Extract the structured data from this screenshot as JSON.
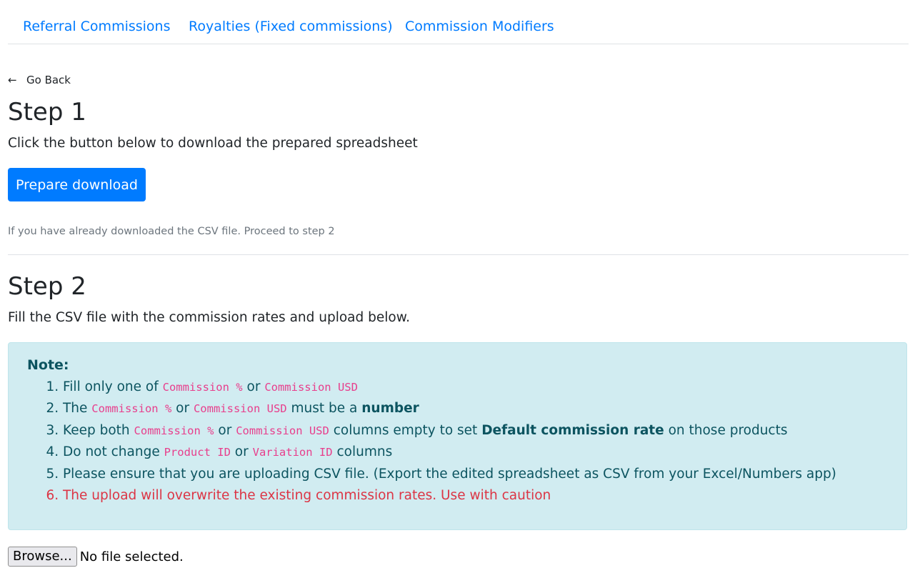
{
  "tabs": [
    "Referral Commissions",
    "Royalties (Fixed commissions)",
    "Commission Modifiers"
  ],
  "back": {
    "arrow": "←",
    "label": "Go Back"
  },
  "step1": {
    "title": "Step 1",
    "text": "Click the button below to download the prepared spreadsheet",
    "button": "Prepare download",
    "hint": "If you have already downloaded the CSV file. Proceed to step 2"
  },
  "step2": {
    "title": "Step 2",
    "text": "Fill the CSV file with the commission rates and upload below."
  },
  "note": {
    "title": "Note:",
    "item1": {
      "a": "Fill only one of ",
      "code1": "Commission %",
      "b": " or ",
      "code2": "Commission USD"
    },
    "item2": {
      "a": "The ",
      "code1": "Commission %",
      "b": " or ",
      "code2": "Commission USD",
      "c": " must be a ",
      "strong": "number"
    },
    "item3": {
      "a": "Keep both ",
      "code1": "Commission %",
      "b": " or ",
      "code2": "Commission USD",
      "c": " columns empty to set ",
      "strong": "Default commission rate",
      "d": " on those products"
    },
    "item4": {
      "a": "Do not change ",
      "code1": "Product ID",
      "b": " or ",
      "code2": "Variation ID",
      "c": " columns"
    },
    "item5": "Please ensure that you are uploading CSV file. (Export the edited spreadsheet as CSV from your Excel/Numbers app)",
    "item6": "The upload will overwrite the existing commission rates. Use with caution"
  },
  "file": {
    "button": "Browse...",
    "status": "No file selected."
  },
  "colors": {
    "primary": "#007bff",
    "info_bg": "#d1ecf1",
    "info_text": "#0c5460",
    "code": "#e83e8c",
    "danger": "#dc3545"
  }
}
